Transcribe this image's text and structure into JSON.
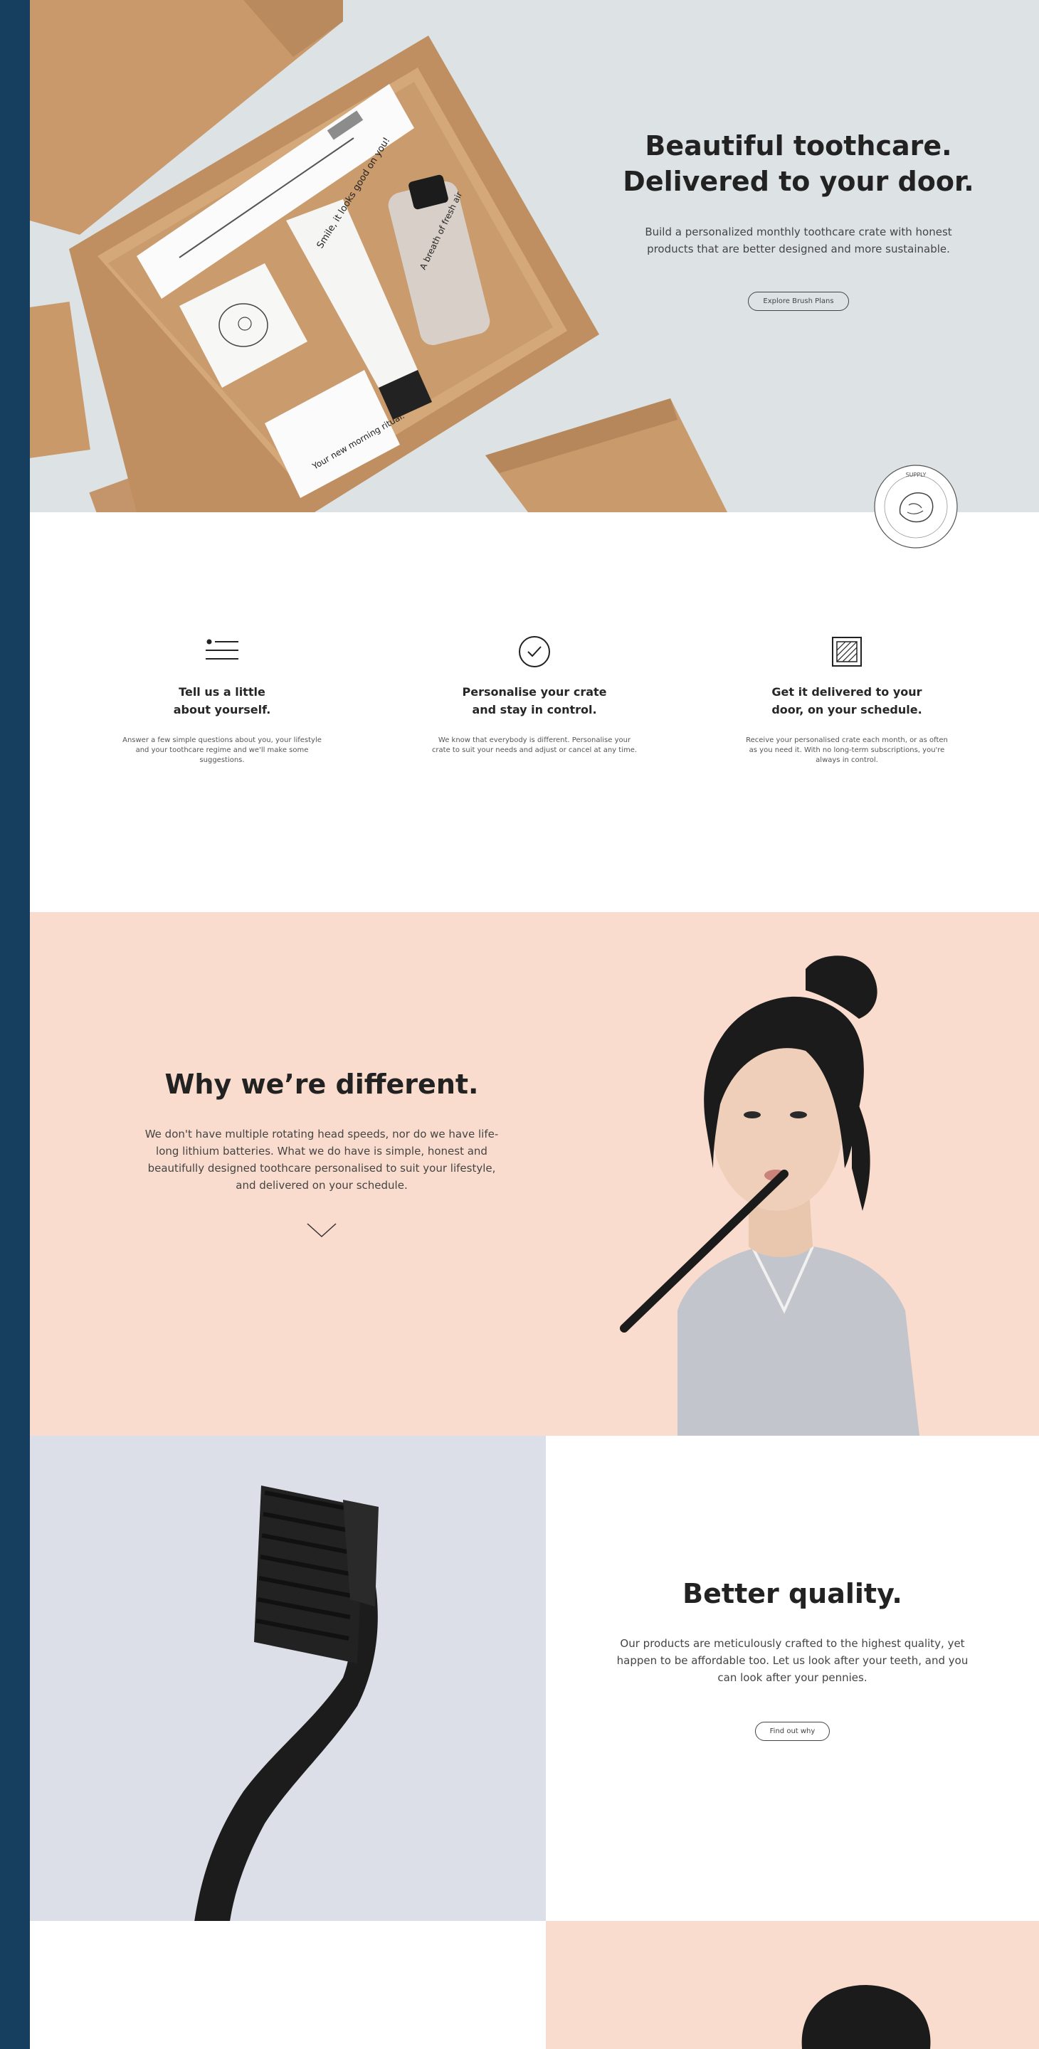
{
  "colors": {
    "page_background": "#163e5f",
    "hero_background": "#dde3e5",
    "peach": "#f9dccd",
    "lavender_grey": "#dcdfe7",
    "kraft": "#c89a6c",
    "ink": "#222222"
  },
  "hero": {
    "title_line1": "Beautiful toothcare.",
    "title_line2": "Delivered to your door.",
    "subtitle": "Build a personalized monthly toothcare crate with honest products that are better designed and more sustainable.",
    "cta_label": "Explore Brush Plans",
    "packaging": {
      "tube_text": "Smile, it looks good on you!",
      "bottle_text": "A breath of fresh air",
      "card_text": "Your new morning ritual."
    },
    "stamp_text": "SUPPLY"
  },
  "steps": [
    {
      "icon": "list-icon",
      "title_line1": "Tell us a little",
      "title_line2": "about yourself.",
      "description": "Answer a few simple questions about you, your lifestyle and your toothcare regime and we'll make some suggestions."
    },
    {
      "icon": "check-circle-icon",
      "title_line1": "Personalise your crate",
      "title_line2": "and stay in control.",
      "description": "We know that everybody is different. Personalise your crate to suit your needs and adjust or cancel at any time."
    },
    {
      "icon": "box-icon",
      "title_line1": "Get it delivered to your",
      "title_line2": "door, on your schedule.",
      "description": "Receive your personalised crate each month, or as often as you need it. With no long-term subscriptions, you're always in control."
    }
  ],
  "why": {
    "title": "Why we’re different.",
    "body": "We don't have multiple rotating head speeds, nor do we have life-long lithium batteries. What we do have is simple, honest and beautifully designed toothcare personalised to suit your lifestyle, and delivered on your schedule."
  },
  "quality": {
    "title": "Better quality.",
    "body": "Our products are meticulously crafted to the highest quality, yet happen to be affordable too. Let us look after your teeth, and you can look after your pennies.",
    "cta_label": "Find out why"
  }
}
